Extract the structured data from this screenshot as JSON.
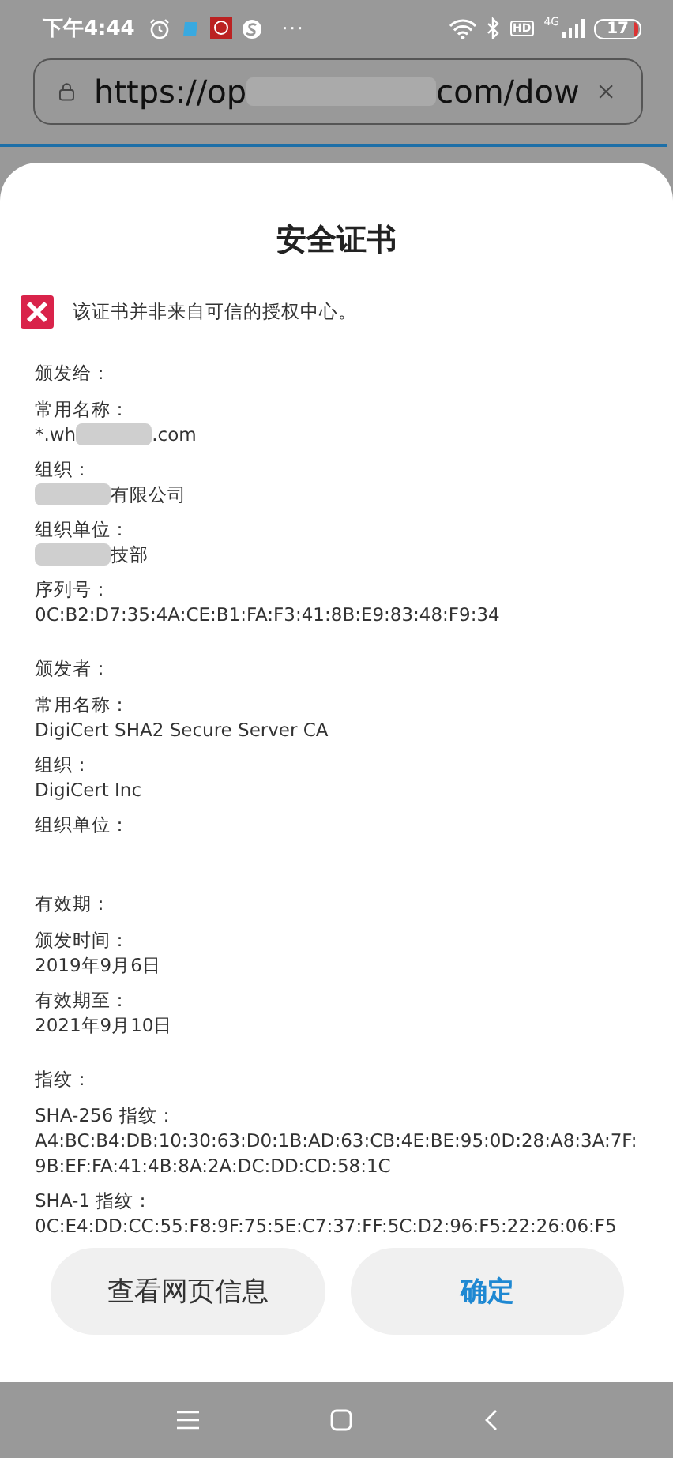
{
  "status_bar": {
    "time": "下午4:44",
    "more": "···",
    "hd": "HD",
    "network": "4G",
    "battery": "17"
  },
  "address_bar": {
    "url_parts": [
      {
        "kind": "text",
        "text": "https://op"
      },
      {
        "kind": "redacted"
      },
      {
        "kind": "text",
        "text": "com/dow"
      }
    ]
  },
  "dialog": {
    "title": "安全证书",
    "warning": "该证书并非来自可信的授权中心。",
    "sections": [
      {
        "heading": "颁发给：",
        "fields": [
          {
            "label": "常用名称：",
            "value": [
              {
                "kind": "text",
                "text": "*.wh"
              },
              {
                "kind": "redacted"
              },
              {
                "kind": "text",
                "text": ".com"
              }
            ]
          },
          {
            "label": "组织：",
            "value": [
              {
                "kind": "redacted"
              },
              {
                "kind": "text",
                "text": "有限公司"
              }
            ]
          },
          {
            "label": "组织单位：",
            "value": [
              {
                "kind": "redacted"
              },
              {
                "kind": "text",
                "text": "技部"
              }
            ]
          },
          {
            "label": "序列号：",
            "value": [
              {
                "kind": "text",
                "text": "0C:B2:D7:35:4A:CE:B1:FA:F3:41:8B:E9:83:48:F9:34"
              }
            ]
          }
        ]
      },
      {
        "heading": "颁发者：",
        "fields": [
          {
            "label": "常用名称：",
            "value": [
              {
                "kind": "text",
                "text": "DigiCert SHA2 Secure Server CA"
              }
            ]
          },
          {
            "label": "组织：",
            "value": [
              {
                "kind": "text",
                "text": "DigiCert Inc"
              }
            ]
          },
          {
            "label": "组织单位："
          }
        ]
      },
      {
        "heading": "有效期：",
        "fields": [
          {
            "label": "颁发时间：",
            "value": [
              {
                "kind": "text",
                "text": "2019年9月6日"
              }
            ]
          },
          {
            "label": "有效期至：",
            "value": [
              {
                "kind": "text",
                "text": "2021年9月10日"
              }
            ]
          }
        ]
      },
      {
        "heading": "指纹：",
        "fields": [
          {
            "label": "SHA-256 指纹：",
            "value": [
              {
                "kind": "text",
                "text": "A4:BC:B4:DB:10:30:63:D0:1B:AD:63:CB:4E:BE:95:0D:28:A8:3A:7F:"
              }
            ],
            "value_2": [
              {
                "kind": "text",
                "text": "9B:EF:FA:41:4B:8A:2A:DC:DD:CD:58:1C"
              }
            ]
          },
          {
            "label": "SHA-1 指纹：",
            "value": [
              {
                "kind": "text",
                "text": "0C:E4:DD:CC:55:F8:9F:75:5E:C7:37:FF:5C:D2:96:F5:22:26:06:F5"
              }
            ]
          }
        ]
      }
    ],
    "buttons": [
      {
        "label": "查看网页信息",
        "primary": false
      },
      {
        "label": "确定",
        "primary": true
      }
    ]
  }
}
